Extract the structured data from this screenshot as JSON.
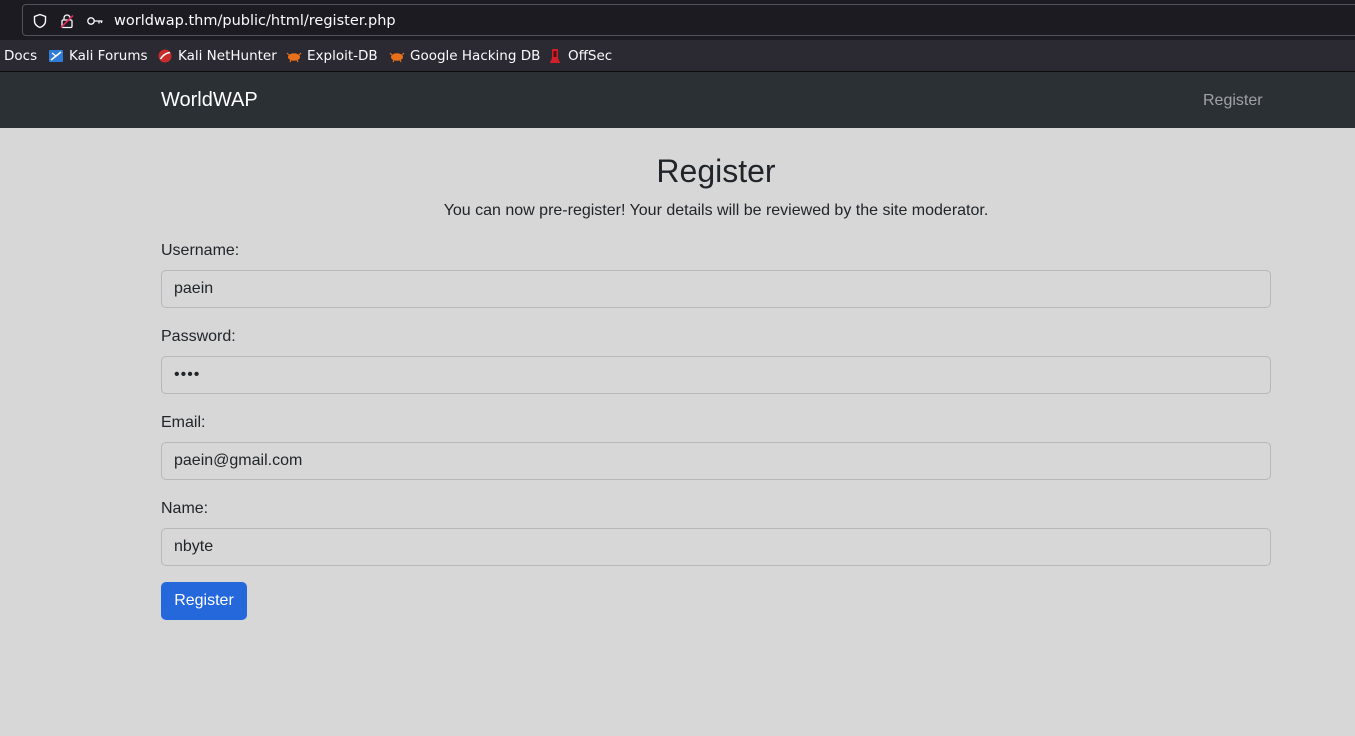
{
  "browser": {
    "url": "worldwap.thm/public/html/register.php",
    "bookmarks": [
      {
        "label": "Docs",
        "icon": "none"
      },
      {
        "label": "Kali Forums",
        "icon": "kali-forums-icon"
      },
      {
        "label": "Kali NetHunter",
        "icon": "kali-nethunter-icon"
      },
      {
        "label": "Exploit-DB",
        "icon": "exploit-db-icon"
      },
      {
        "label": "Google Hacking DB",
        "icon": "ghdb-icon"
      },
      {
        "label": "OffSec",
        "icon": "offsec-icon"
      }
    ]
  },
  "navbar": {
    "brand": "WorldWAP",
    "register_link": "Register"
  },
  "page": {
    "title": "Register",
    "subtitle": "You can now pre-register! Your details will be reviewed by the site moderator."
  },
  "form": {
    "username_label": "Username:",
    "username_value": "paein",
    "password_label": "Password:",
    "password_value": "••••",
    "email_label": "Email:",
    "email_value": "paein@gmail.com",
    "name_label": "Name:",
    "name_value": "nbyte",
    "submit_label": "Register"
  },
  "colors": {
    "page_bg": "#d7d7d7",
    "navbar_bg": "#2b3035",
    "button_bg": "#2468dc"
  }
}
